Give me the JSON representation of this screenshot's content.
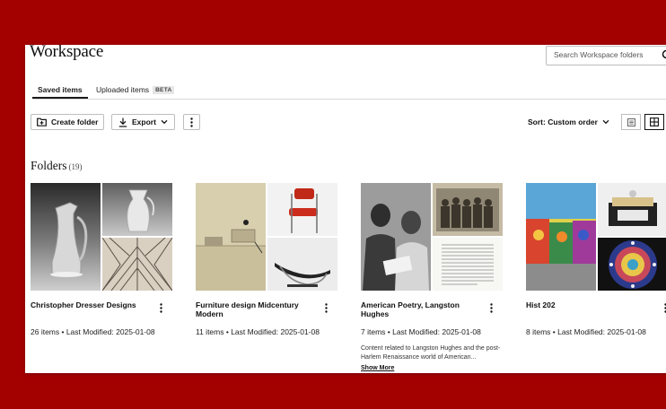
{
  "page": {
    "title": "Workspace",
    "search_placeholder": "Search Workspace folders",
    "colors": {
      "frame": "#a30000",
      "panel": "#ffffff",
      "text": "#111111"
    }
  },
  "tabs": [
    {
      "label": "Saved items",
      "active": true
    },
    {
      "label": "Uploaded items",
      "badge": "BETA",
      "active": false
    }
  ],
  "toolbar": {
    "create_label": "Create folder",
    "export_label": "Export",
    "sort_label": "Sort: Custom order",
    "view_modes": [
      "list-view-icon",
      "grid-view-icon"
    ],
    "active_view": "grid"
  },
  "folders_section": {
    "heading": "Folders",
    "count": "(19)"
  },
  "folders": [
    {
      "title": "Christopher Dresser Designs",
      "meta": "26 items • Last Modified: 2025-01-08",
      "images": [
        "silver-claret-jug",
        "glass-and-silver-jug",
        "art-deco-textile-pattern"
      ]
    },
    {
      "title": "Furniture design Midcentury Modern",
      "meta": "11 items • Last Modified: 2025-01-08",
      "images": [
        "furniture-print",
        "red-chair",
        "chaise-longue"
      ]
    },
    {
      "title": "American Poetry, Langston Hughes",
      "meta": "7 items • Last Modified: 2025-01-08",
      "description": "Content related to Langston Hughes and the post-Harlem Renaissance world of American...",
      "show_more": "Show More",
      "images": [
        "portrait-photo",
        "group-photo",
        "printed-page"
      ]
    },
    {
      "title": "Hist 202",
      "meta": "8 items • Last Modified: 2025-01-08",
      "images": [
        "mural-wall",
        "machine-object",
        "mosaic-plate"
      ]
    }
  ]
}
